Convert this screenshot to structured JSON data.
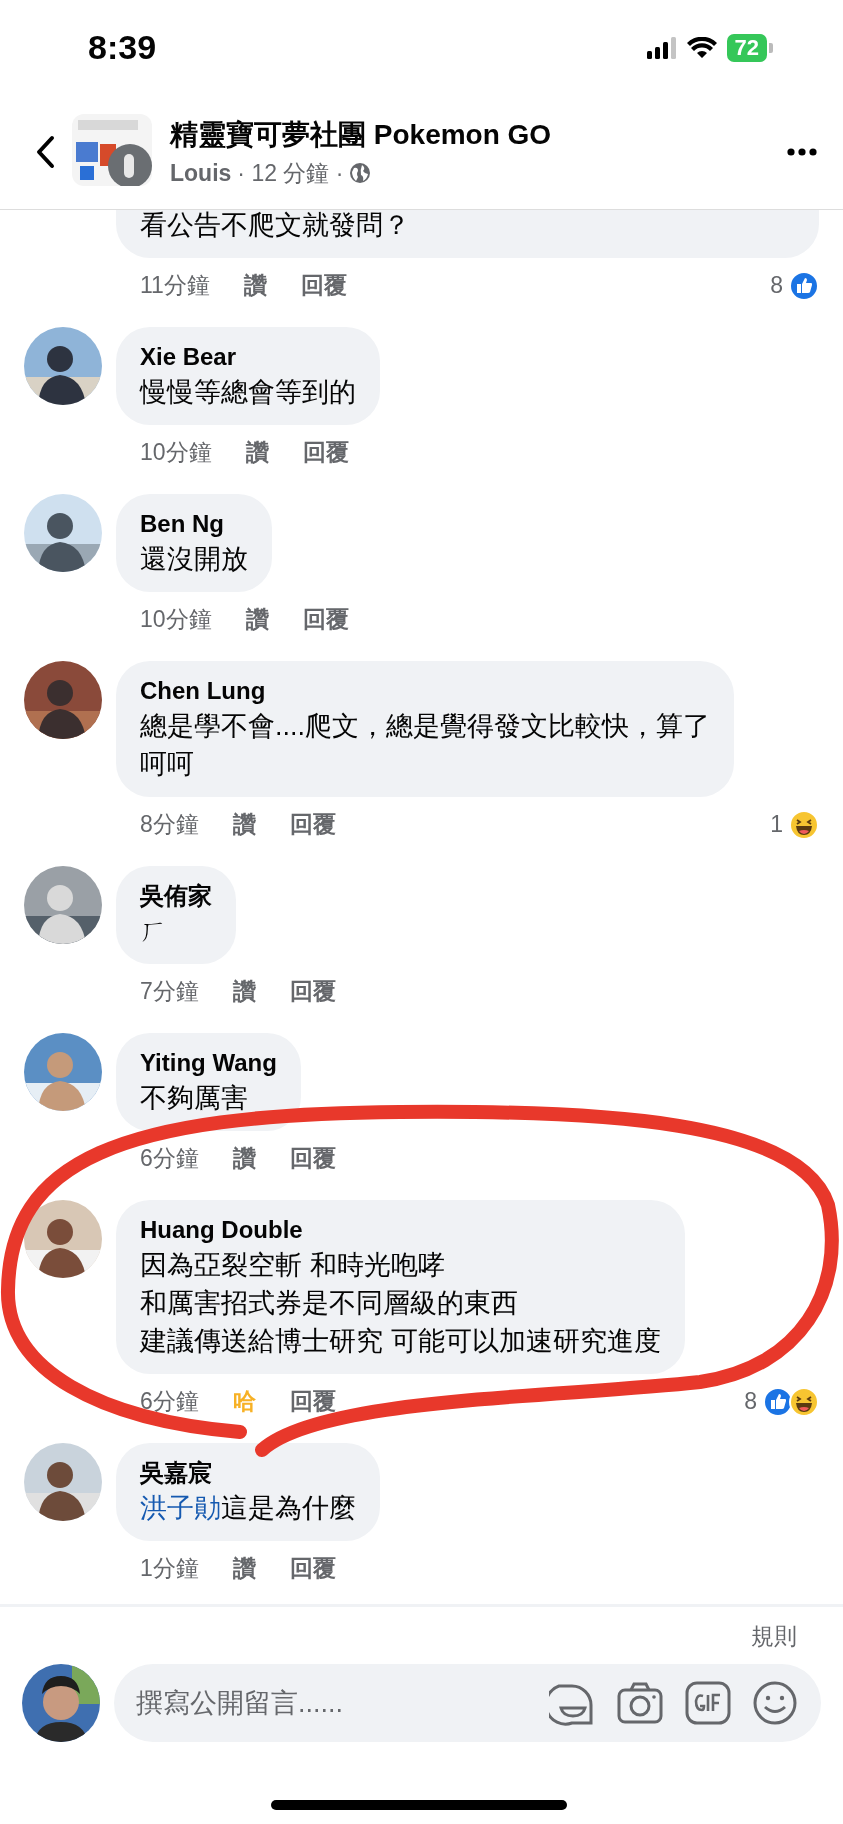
{
  "status_bar": {
    "time": "8:39",
    "battery": "72"
  },
  "header": {
    "title": "精靈寶可夢社團 Pokemon GO",
    "author": "Louis",
    "time": "· 12 分鐘 ·"
  },
  "comments": [
    {
      "text": [
        "看公告不爬文就發問？"
      ],
      "time": "11分鐘",
      "reaction": "讚",
      "reacted": false,
      "reply": "回覆",
      "count": "8",
      "reactions": [
        {
          "kind": "like"
        }
      ]
    },
    {
      "name": "Xie Bear",
      "text": [
        "慢慢等總會等到的"
      ],
      "time": "10分鐘",
      "reaction": "讚",
      "reacted": false,
      "reply": "回覆"
    },
    {
      "name": "Ben Ng",
      "text": [
        "還沒開放"
      ],
      "time": "10分鐘",
      "reaction": "讚",
      "reacted": false,
      "reply": "回覆"
    },
    {
      "name": "Chen Lung",
      "text": [
        "總是學不會....爬文，總是覺得發文比較快，算了",
        "呵呵"
      ],
      "time": "8分鐘",
      "reaction": "讚",
      "reacted": false,
      "reply": "回覆",
      "count": "1",
      "reactions": [
        {
          "kind": "laugh"
        }
      ]
    },
    {
      "name": "吳侑家",
      "text": [
        "ㄏ"
      ],
      "time": "7分鐘",
      "reaction": "讚",
      "reacted": false,
      "reply": "回覆"
    },
    {
      "name": "Yiting Wang",
      "text": [
        "不夠厲害"
      ],
      "time": "6分鐘",
      "reaction": "讚",
      "reacted": false,
      "reply": "回覆"
    },
    {
      "name": "Huang Double",
      "text": [
        "因為亞裂空斬 和時光咆哮",
        "和厲害招式券是不同層級的東西",
        "建議傳送給博士研究 可能可以加速研究進度"
      ],
      "time": "6分鐘",
      "reaction": "哈",
      "reacted": true,
      "reply": "回覆",
      "count": "8",
      "reactions": [
        {
          "kind": "like"
        },
        {
          "kind": "laugh"
        }
      ]
    },
    {
      "name": "吳嘉宸",
      "mention": "洪子勛",
      "text": [
        "這是為什麼"
      ],
      "time": "1分鐘",
      "reaction": "讚",
      "reacted": false,
      "reply": "回覆"
    }
  ],
  "footer": {
    "rules": "規則",
    "placeholder": "撰寫公開留言......"
  }
}
